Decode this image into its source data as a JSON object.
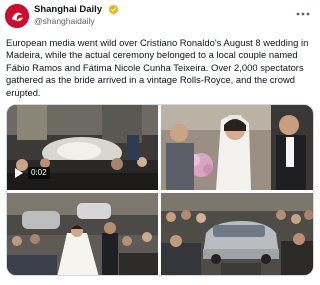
{
  "account": {
    "display_name": "Shanghai Daily",
    "handle": "@shanghaidaily",
    "verified": true
  },
  "post": {
    "text": "European media went wild over Cristiano Ronaldo's August 8 wedding in Madeira, while the actual ceremony belonged to a local couple named Fábio Ramos and Fátima Nicole Cunha Teixeira. Over 2,000 spectators gathered as the bride arrived in a vintage Rolls-Royce, and the crowd erupted."
  },
  "media": {
    "video_duration": "0:02",
    "tiles": [
      {
        "name": "wedding-crowd-street"
      },
      {
        "name": "bride-and-groom"
      },
      {
        "name": "bride-crowd-cars"
      },
      {
        "name": "rolls-royce-crowd"
      }
    ]
  },
  "colors": {
    "brand_red": "#c8102e",
    "verified_gold": "#e2b719",
    "text_primary": "#0f1419",
    "text_secondary": "#536471"
  }
}
